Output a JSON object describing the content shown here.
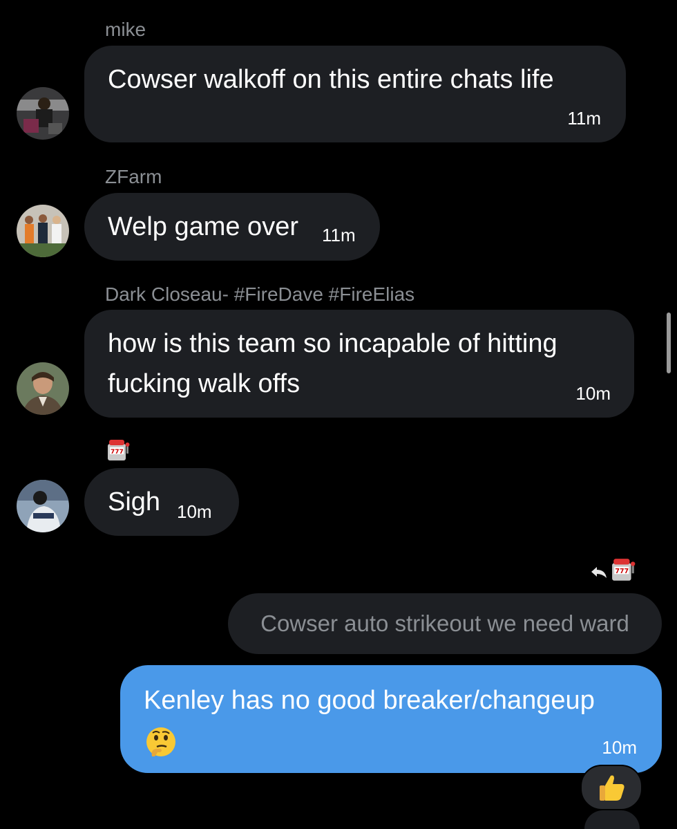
{
  "messages": [
    {
      "sender": "mike",
      "text": "Cowser walkoff on this entire chats life",
      "time": "11m"
    },
    {
      "sender": "ZFarm",
      "text": "Welp game over",
      "time": "11m"
    },
    {
      "sender": "Dark Closeau- #FireDave #FireElias",
      "text_line1": "how is this team so incapable of hitting",
      "text_line2": "fucking walk offs",
      "time": "10m"
    },
    {
      "sender_emoji": "slot-machine-icon",
      "text": "Sigh",
      "time": "10m"
    }
  ],
  "reply": {
    "quoted_text": "Cowser auto strikeout we need ward",
    "reply_icon": "reply-arrow-icon",
    "replied_to_avatar": "slot-machine-icon"
  },
  "own_message": {
    "text_line1": "Kenley has no good breaker/changeup",
    "emoji": "thinking-face-emoji",
    "time": "10m",
    "reaction": "thumbs-up-emoji"
  },
  "colors": {
    "background": "#000000",
    "bubble_dark": "#1d1f23",
    "bubble_blue": "#4a99e9",
    "name_gray": "#8b8f94"
  }
}
